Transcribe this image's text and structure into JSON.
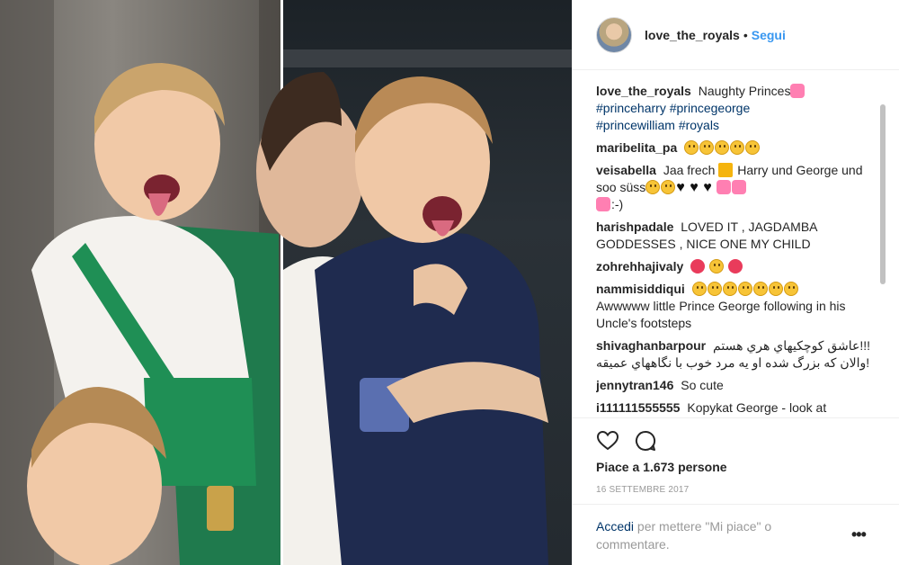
{
  "header": {
    "username": "love_the_royals",
    "separator": "•",
    "follow_label": "Segui"
  },
  "caption": {
    "username": "love_the_royals",
    "text": "Naughty Princes",
    "hashtags": [
      "#princeharry",
      "#princegeorge",
      "#princewilliam",
      "#royals"
    ]
  },
  "comments": [
    {
      "username": "maribelita_pa",
      "text": "",
      "emoji": [
        "laughing",
        "laughing",
        "laughing",
        "laughing",
        "laughing"
      ]
    },
    {
      "username": "veisabella",
      "text": "Jaa frech",
      "text2": "Harry und George und soo süss",
      "text3": ":-)"
    },
    {
      "username": "harishpadale",
      "text": "LOVED IT , JAGDAMBA GODDESSES , NICE ONE MY CHILD"
    },
    {
      "username": "zohrehhajivaly",
      "text": ""
    },
    {
      "username": "nammisiddiqui",
      "text": "Awwwww little Prince George following in his Uncle's footsteps"
    },
    {
      "username": "shivaghanbarpour",
      "text": "!!!عاشق كوچكيهاي هري هستم",
      "text2": "!والان كه بزرگ شده او يه مرد خوب با نگاههاي عميقه"
    },
    {
      "username": "jennytran146",
      "text": "So cute"
    },
    {
      "username": "i111111555555",
      "text": "Kopykat George - look at"
    }
  ],
  "actions": {
    "like_icon": "heart-outline-icon",
    "comment_icon": "speech-bubble-icon",
    "likes_text": "Piace a 1.673 persone",
    "date": "16 settembre 2017"
  },
  "login": {
    "link": "Accedi",
    "rest": "per mettere \"Mi piace\" o commentare.",
    "more_icon": "ellipsis-icon",
    "more_label": "•••"
  },
  "colors": {
    "accent": "#3897f0",
    "hashtag": "#003569",
    "muted": "#999999",
    "divider": "#efefef"
  }
}
